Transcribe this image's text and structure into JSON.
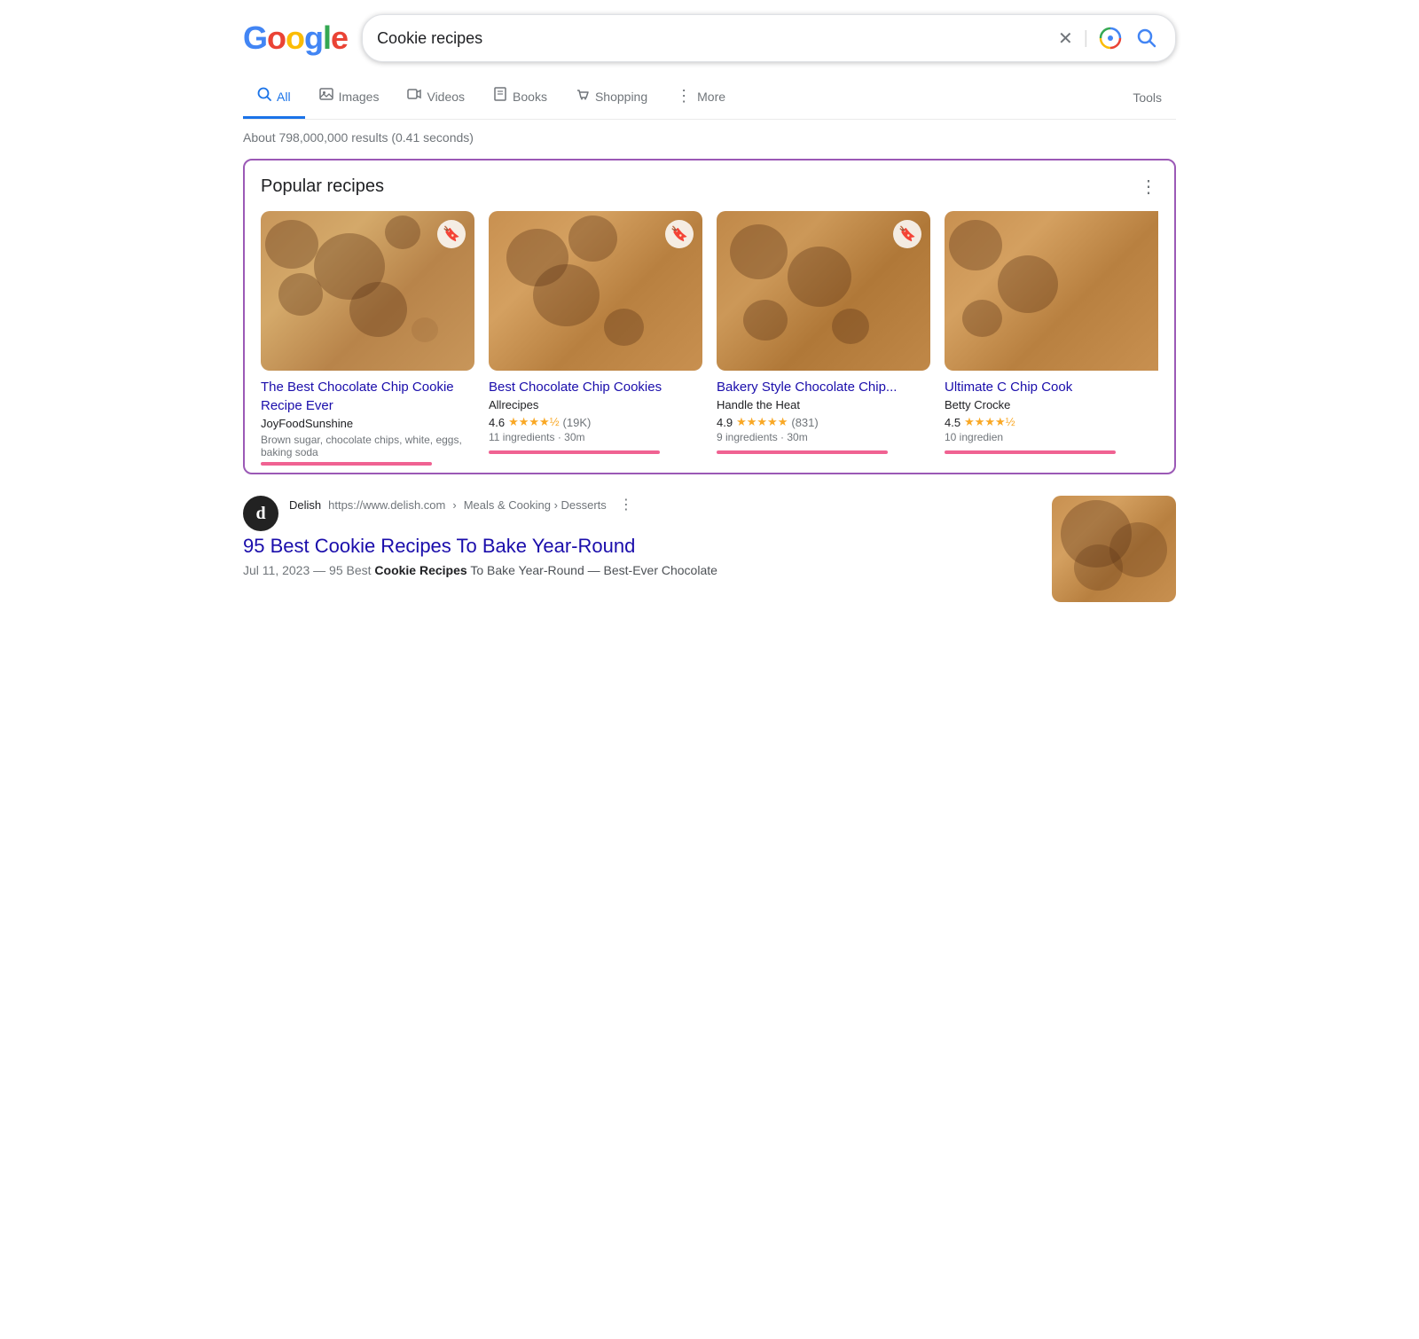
{
  "header": {
    "logo": "Google",
    "search_value": "Cookie recipes",
    "clear_label": "×",
    "search_label": "Search"
  },
  "nav": {
    "tabs": [
      {
        "id": "all",
        "label": "All",
        "icon": "🔍",
        "active": true
      },
      {
        "id": "images",
        "label": "Images",
        "icon": "🖼"
      },
      {
        "id": "videos",
        "label": "Videos",
        "icon": "▶"
      },
      {
        "id": "books",
        "label": "Books",
        "icon": "📖"
      },
      {
        "id": "shopping",
        "label": "Shopping",
        "icon": "🏷"
      },
      {
        "id": "more",
        "label": "More",
        "icon": "⋮"
      }
    ],
    "tools_label": "Tools"
  },
  "results_count": "About 798,000,000 results (0.41 seconds)",
  "popular_recipes": {
    "title": "Popular recipes",
    "cards": [
      {
        "id": 1,
        "title": "The Best Chocolate Chip Cookie Recipe Ever",
        "source": "JoyFoodSunshine",
        "desc": "Brown sugar, chocolate chips, white, eggs, baking soda",
        "rating": null,
        "rating_count": null,
        "meta": null
      },
      {
        "id": 2,
        "title": "Best Chocolate Chip Cookies",
        "source": "Allrecipes",
        "desc": null,
        "rating": "4.6",
        "stars": "★★★★½",
        "rating_count": "(19K)",
        "meta": "11 ingredients · 30m"
      },
      {
        "id": 3,
        "title": "Bakery Style Chocolate Chip...",
        "source": "Handle the Heat",
        "desc": null,
        "rating": "4.9",
        "stars": "★★★★★",
        "rating_count": "(831)",
        "meta": "9 ingredients · 30m"
      },
      {
        "id": 4,
        "title": "Ultimate C Chip Cook",
        "source": "Betty Crocke",
        "desc": null,
        "rating": "4.5",
        "stars": "★★★★½",
        "rating_count": "",
        "meta": "10 ingredien"
      }
    ]
  },
  "web_results": [
    {
      "id": "delish",
      "favicon_letter": "d",
      "site_name": "Delish",
      "url": "https://www.delish.com",
      "breadcrumb": "Meals & Cooking › Desserts",
      "title": "95 Best Cookie Recipes To Bake Year-Round",
      "date": "Jul 11, 2023",
      "snippet": "95 Best Cookie Recipes To Bake Year-Round — Best-Ever Chocolate"
    }
  ]
}
